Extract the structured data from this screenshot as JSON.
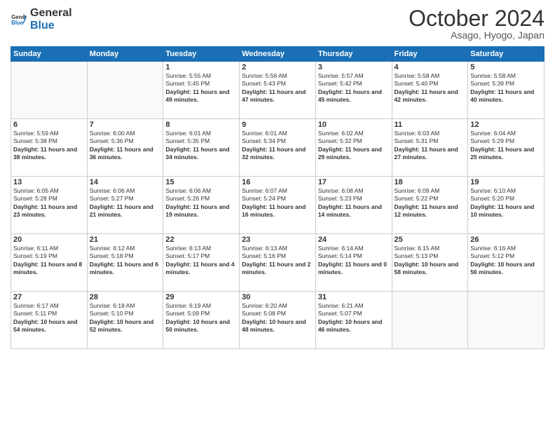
{
  "header": {
    "logo_line1": "General",
    "logo_line2": "Blue",
    "month": "October 2024",
    "location": "Asago, Hyogo, Japan"
  },
  "weekdays": [
    "Sunday",
    "Monday",
    "Tuesday",
    "Wednesday",
    "Thursday",
    "Friday",
    "Saturday"
  ],
  "weeks": [
    [
      {
        "day": "",
        "text": ""
      },
      {
        "day": "",
        "text": ""
      },
      {
        "day": "1",
        "text": "Sunrise: 5:55 AM\nSunset: 5:45 PM\nDaylight: 11 hours and 49 minutes."
      },
      {
        "day": "2",
        "text": "Sunrise: 5:56 AM\nSunset: 5:43 PM\nDaylight: 11 hours and 47 minutes."
      },
      {
        "day": "3",
        "text": "Sunrise: 5:57 AM\nSunset: 5:42 PM\nDaylight: 11 hours and 45 minutes."
      },
      {
        "day": "4",
        "text": "Sunrise: 5:58 AM\nSunset: 5:40 PM\nDaylight: 11 hours and 42 minutes."
      },
      {
        "day": "5",
        "text": "Sunrise: 5:58 AM\nSunset: 5:39 PM\nDaylight: 11 hours and 40 minutes."
      }
    ],
    [
      {
        "day": "6",
        "text": "Sunrise: 5:59 AM\nSunset: 5:38 PM\nDaylight: 11 hours and 38 minutes."
      },
      {
        "day": "7",
        "text": "Sunrise: 6:00 AM\nSunset: 5:36 PM\nDaylight: 11 hours and 36 minutes."
      },
      {
        "day": "8",
        "text": "Sunrise: 6:01 AM\nSunset: 5:35 PM\nDaylight: 11 hours and 34 minutes."
      },
      {
        "day": "9",
        "text": "Sunrise: 6:01 AM\nSunset: 5:34 PM\nDaylight: 11 hours and 32 minutes."
      },
      {
        "day": "10",
        "text": "Sunrise: 6:02 AM\nSunset: 5:32 PM\nDaylight: 11 hours and 29 minutes."
      },
      {
        "day": "11",
        "text": "Sunrise: 6:03 AM\nSunset: 5:31 PM\nDaylight: 11 hours and 27 minutes."
      },
      {
        "day": "12",
        "text": "Sunrise: 6:04 AM\nSunset: 5:29 PM\nDaylight: 11 hours and 25 minutes."
      }
    ],
    [
      {
        "day": "13",
        "text": "Sunrise: 6:05 AM\nSunset: 5:28 PM\nDaylight: 11 hours and 23 minutes."
      },
      {
        "day": "14",
        "text": "Sunrise: 6:06 AM\nSunset: 5:27 PM\nDaylight: 11 hours and 21 minutes."
      },
      {
        "day": "15",
        "text": "Sunrise: 6:06 AM\nSunset: 5:26 PM\nDaylight: 11 hours and 19 minutes."
      },
      {
        "day": "16",
        "text": "Sunrise: 6:07 AM\nSunset: 5:24 PM\nDaylight: 11 hours and 16 minutes."
      },
      {
        "day": "17",
        "text": "Sunrise: 6:08 AM\nSunset: 5:23 PM\nDaylight: 11 hours and 14 minutes."
      },
      {
        "day": "18",
        "text": "Sunrise: 6:09 AM\nSunset: 5:22 PM\nDaylight: 11 hours and 12 minutes."
      },
      {
        "day": "19",
        "text": "Sunrise: 6:10 AM\nSunset: 5:20 PM\nDaylight: 11 hours and 10 minutes."
      }
    ],
    [
      {
        "day": "20",
        "text": "Sunrise: 6:11 AM\nSunset: 5:19 PM\nDaylight: 11 hours and 8 minutes."
      },
      {
        "day": "21",
        "text": "Sunrise: 6:12 AM\nSunset: 5:18 PM\nDaylight: 11 hours and 6 minutes."
      },
      {
        "day": "22",
        "text": "Sunrise: 6:13 AM\nSunset: 5:17 PM\nDaylight: 11 hours and 4 minutes."
      },
      {
        "day": "23",
        "text": "Sunrise: 6:13 AM\nSunset: 5:16 PM\nDaylight: 11 hours and 2 minutes."
      },
      {
        "day": "24",
        "text": "Sunrise: 6:14 AM\nSunset: 5:14 PM\nDaylight: 11 hours and 0 minutes."
      },
      {
        "day": "25",
        "text": "Sunrise: 6:15 AM\nSunset: 5:13 PM\nDaylight: 10 hours and 58 minutes."
      },
      {
        "day": "26",
        "text": "Sunrise: 6:16 AM\nSunset: 5:12 PM\nDaylight: 10 hours and 56 minutes."
      }
    ],
    [
      {
        "day": "27",
        "text": "Sunrise: 6:17 AM\nSunset: 5:11 PM\nDaylight: 10 hours and 54 minutes."
      },
      {
        "day": "28",
        "text": "Sunrise: 6:18 AM\nSunset: 5:10 PM\nDaylight: 10 hours and 52 minutes."
      },
      {
        "day": "29",
        "text": "Sunrise: 6:19 AM\nSunset: 5:09 PM\nDaylight: 10 hours and 50 minutes."
      },
      {
        "day": "30",
        "text": "Sunrise: 6:20 AM\nSunset: 5:08 PM\nDaylight: 10 hours and 48 minutes."
      },
      {
        "day": "31",
        "text": "Sunrise: 6:21 AM\nSunset: 5:07 PM\nDaylight: 10 hours and 46 minutes."
      },
      {
        "day": "",
        "text": ""
      },
      {
        "day": "",
        "text": ""
      }
    ]
  ]
}
